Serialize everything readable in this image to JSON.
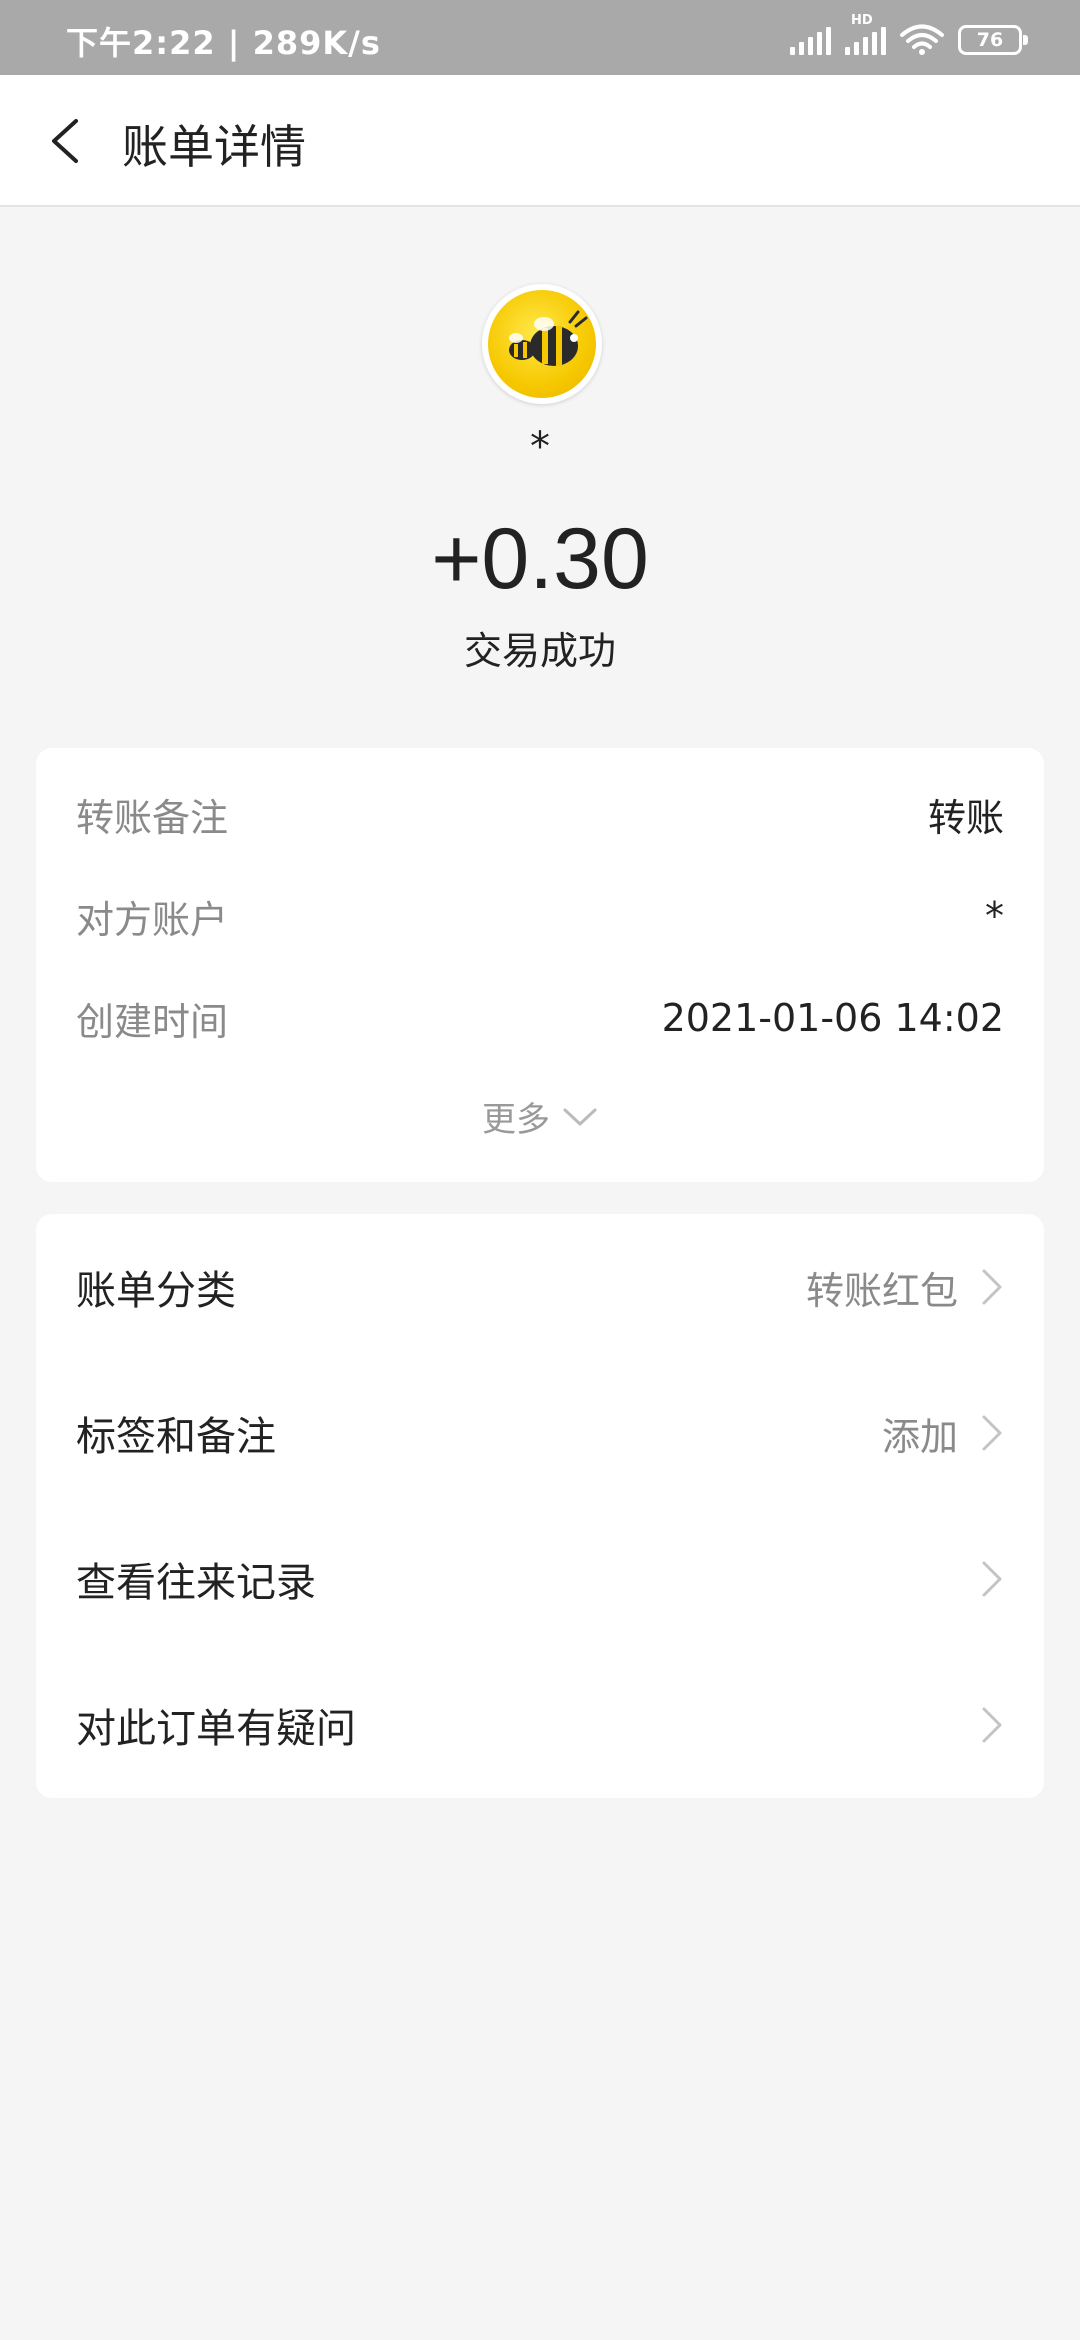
{
  "status_bar": {
    "time": "下午2:22 | 289K/s",
    "signal_hd": "HD",
    "battery": "76"
  },
  "header": {
    "title": "账单详情",
    "back_icon": "chevron-left-icon"
  },
  "summary": {
    "avatar_icon": "bee-avatar-icon",
    "name": "*",
    "amount": "+0.30",
    "status": "交易成功"
  },
  "details": {
    "rows": [
      {
        "label": "转账备注",
        "value": "转账"
      },
      {
        "label": "对方账户",
        "value": "*"
      },
      {
        "label": "创建时间",
        "value": "2021-01-06 14:02"
      }
    ],
    "more_label": "更多"
  },
  "actions": {
    "rows": [
      {
        "label": "账单分类",
        "value": "转账红包"
      },
      {
        "label": "标签和备注",
        "value": "添加"
      },
      {
        "label": "查看往来记录",
        "value": ""
      },
      {
        "label": "对此订单有疑问",
        "value": ""
      }
    ]
  },
  "colors": {
    "status_bar_bg": "#a9a9a9",
    "page_bg": "#f5f5f5",
    "avatar_yellow": "#f6c800"
  }
}
